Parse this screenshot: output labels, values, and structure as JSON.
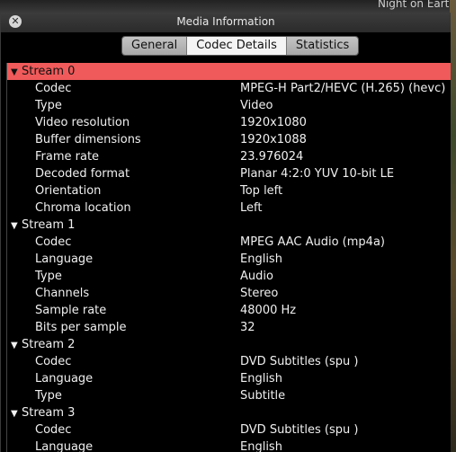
{
  "background": {
    "text": "Night on Earth"
  },
  "window": {
    "title": "Media Information",
    "close_icon": "close-icon"
  },
  "tabs": [
    {
      "label": "General",
      "active": false
    },
    {
      "label": "Codec Details",
      "active": true
    },
    {
      "label": "Statistics",
      "active": false
    }
  ],
  "colors": {
    "selected_row": "#f05a5a",
    "window_bg": "#000000",
    "text": "#f0f0f0"
  },
  "streams": [
    {
      "label": "Stream 0",
      "selected": true,
      "props": [
        {
          "key": "Codec",
          "value": "MPEG-H Part2/HEVC (H.265) (hevc)"
        },
        {
          "key": "Type",
          "value": "Video"
        },
        {
          "key": "Video resolution",
          "value": "1920x1080"
        },
        {
          "key": "Buffer dimensions",
          "value": "1920x1088"
        },
        {
          "key": "Frame rate",
          "value": "23.976024"
        },
        {
          "key": "Decoded format",
          "value": "Planar 4:2:0 YUV 10-bit LE"
        },
        {
          "key": "Orientation",
          "value": "Top left"
        },
        {
          "key": "Chroma location",
          "value": "Left"
        }
      ]
    },
    {
      "label": "Stream 1",
      "selected": false,
      "props": [
        {
          "key": "Codec",
          "value": "MPEG AAC Audio (mp4a)"
        },
        {
          "key": "Language",
          "value": "English"
        },
        {
          "key": "Type",
          "value": "Audio"
        },
        {
          "key": "Channels",
          "value": "Stereo"
        },
        {
          "key": "Sample rate",
          "value": "48000 Hz"
        },
        {
          "key": "Bits per sample",
          "value": "32"
        }
      ]
    },
    {
      "label": "Stream 2",
      "selected": false,
      "props": [
        {
          "key": "Codec",
          "value": "DVD Subtitles (spu )"
        },
        {
          "key": "Language",
          "value": "English"
        },
        {
          "key": "Type",
          "value": "Subtitle"
        }
      ]
    },
    {
      "label": "Stream 3",
      "selected": false,
      "props": [
        {
          "key": "Codec",
          "value": "DVD Subtitles (spu )"
        },
        {
          "key": "Language",
          "value": "English"
        }
      ]
    }
  ]
}
